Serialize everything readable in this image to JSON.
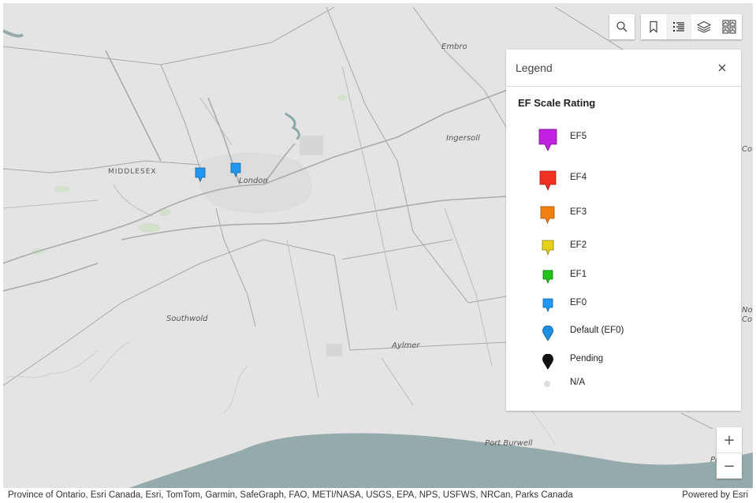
{
  "map": {
    "places": {
      "embro": "Embro",
      "ingersoll": "Ingersoll",
      "middlesex": "MIDDLESEX",
      "london": "London",
      "southwold": "Southwold",
      "aylmer": "Aylmer",
      "port_burwell": "Port Burwell",
      "port_rowan_fragment": "Port Ro",
      "cot_fragment": "Cot",
      "nor_fragment": "Nor",
      "co_fragment": "Co"
    },
    "markers": [
      {
        "rating": "EF0",
        "color": "#2196f3"
      },
      {
        "rating": "EF0",
        "color": "#2196f3"
      }
    ],
    "colors": {
      "land": "#e4e4e4",
      "water": "#95aaaa",
      "roads": "#9a9a9a"
    }
  },
  "toolbar": {
    "search_icon": "search-icon",
    "bookmarks_icon": "bookmark-icon",
    "legend_icon": "legend-list-icon",
    "layers_icon": "layers-icon",
    "basemap_icon": "basemap-gallery-icon"
  },
  "legend": {
    "title": "Legend",
    "layer_title": "EF Scale Rating",
    "items": [
      {
        "label": "EF5",
        "color": "#c020e0"
      },
      {
        "label": "EF4",
        "color": "#f03020"
      },
      {
        "label": "EF3",
        "color": "#f08010"
      },
      {
        "label": "EF2",
        "color": "#e6d21a"
      },
      {
        "label": "EF1",
        "color": "#22c31c"
      },
      {
        "label": "EF0",
        "color": "#2196f3"
      },
      {
        "label": "Default (EF0)",
        "color": "#1e90e0"
      },
      {
        "label": "Pending",
        "color": "#111111"
      },
      {
        "label": "N/A",
        "color": "#dddddd"
      }
    ]
  },
  "zoom": {
    "in": "+",
    "out": "−"
  },
  "attribution": {
    "sources": "Province of Ontario, Esri Canada, Esri, TomTom, Garmin, SafeGraph, FAO, METI/NASA, USGS, EPA, NPS, USFWS, NRCan, Parks Canada",
    "powered_by": "Powered by Esri"
  }
}
